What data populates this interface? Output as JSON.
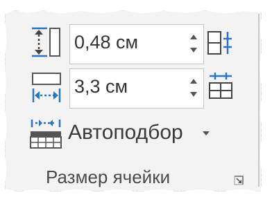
{
  "cell_size_group": {
    "height_field": {
      "value": "0,48 см",
      "icon": "table-row-height-icon"
    },
    "width_field": {
      "value": "3,3 см",
      "icon": "table-column-width-icon"
    },
    "distribute_rows_icon": "distribute-rows-icon",
    "distribute_columns_icon": "distribute-columns-icon",
    "autofit": {
      "label": "Автоподбор",
      "icon": "autofit-table-icon"
    },
    "label": "Размер ячейки",
    "launcher_icon": "dialog-launcher-icon"
  },
  "colors": {
    "accent_blue": "#2b73c4",
    "ribbon_bg": "#f3f3f3",
    "text": "#333333"
  }
}
